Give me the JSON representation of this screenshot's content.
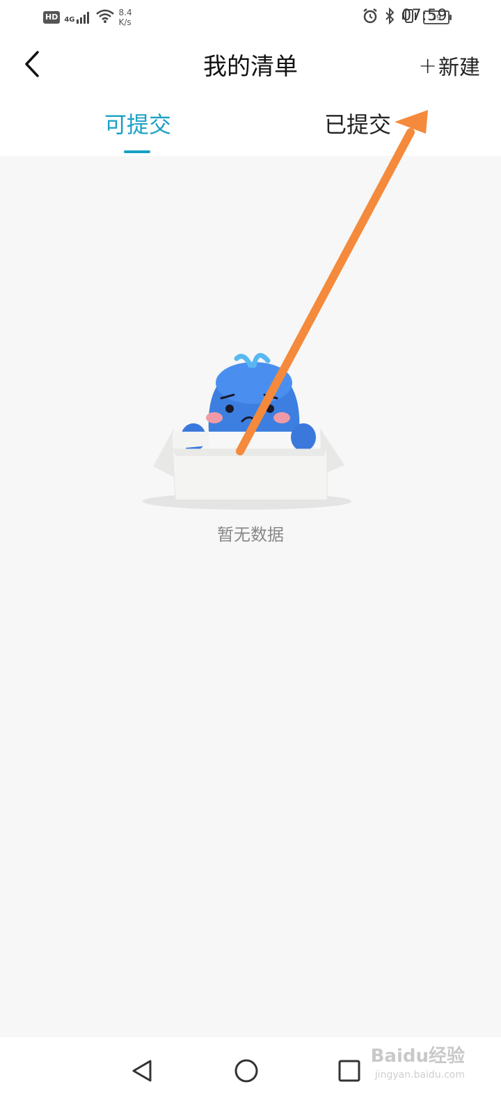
{
  "status_bar": {
    "hd": "HD",
    "signal": "4G",
    "speed_value": "8.4",
    "speed_unit": "K/s",
    "battery": "39",
    "time": "07:59",
    "icons": [
      "hd-badge",
      "cellular-signal-icon",
      "wifi-icon",
      "alarm-icon",
      "bluetooth-icon",
      "vibrate-icon",
      "battery-icon"
    ]
  },
  "header": {
    "title": "我的清单",
    "new_label": "新建",
    "new_plus": "+"
  },
  "tabs": [
    {
      "label": "可提交",
      "active": true
    },
    {
      "label": "已提交",
      "active": false
    }
  ],
  "empty_state": {
    "text": "暂无数据"
  },
  "watermark": {
    "brand": "Baidu经验",
    "url": "jingyan.baidu.com"
  },
  "colors": {
    "accent": "#1aa0c4",
    "background": "#f6f7f6",
    "arrow": "#f58a3c"
  }
}
